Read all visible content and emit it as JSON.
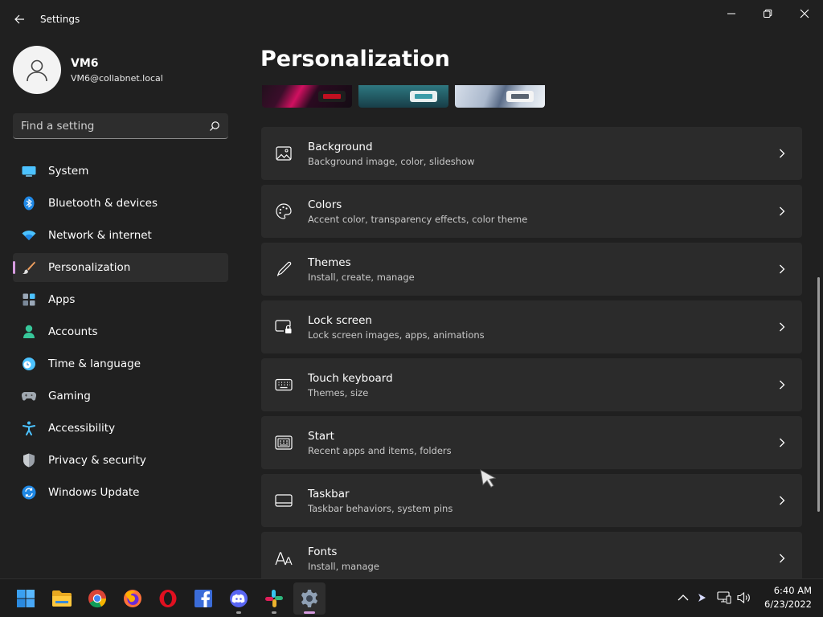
{
  "window": {
    "app_title": "Settings"
  },
  "profile": {
    "name": "VM6",
    "email": "VM6@collabnet.local"
  },
  "search": {
    "placeholder": "Find a setting"
  },
  "sidebar": {
    "items": [
      {
        "label": "System",
        "icon": "system-icon",
        "selected": false
      },
      {
        "label": "Bluetooth & devices",
        "icon": "bluetooth-icon",
        "selected": false
      },
      {
        "label": "Network & internet",
        "icon": "wifi-icon",
        "selected": false
      },
      {
        "label": "Personalization",
        "icon": "brush-icon",
        "selected": true
      },
      {
        "label": "Apps",
        "icon": "apps-icon",
        "selected": false
      },
      {
        "label": "Accounts",
        "icon": "accounts-icon",
        "selected": false
      },
      {
        "label": "Time & language",
        "icon": "globe-clock-icon",
        "selected": false
      },
      {
        "label": "Gaming",
        "icon": "gamepad-icon",
        "selected": false
      },
      {
        "label": "Accessibility",
        "icon": "accessibility-icon",
        "selected": false
      },
      {
        "label": "Privacy & security",
        "icon": "shield-icon",
        "selected": false
      },
      {
        "label": "Windows Update",
        "icon": "update-icon",
        "selected": false
      }
    ]
  },
  "main": {
    "title": "Personalization",
    "settings": [
      {
        "title": "Background",
        "desc": "Background image, color, slideshow",
        "icon": "image-icon"
      },
      {
        "title": "Colors",
        "desc": "Accent color, transparency effects, color theme",
        "icon": "palette-icon"
      },
      {
        "title": "Themes",
        "desc": "Install, create, manage",
        "icon": "pen-icon"
      },
      {
        "title": "Lock screen",
        "desc": "Lock screen images, apps, animations",
        "icon": "lock-screen-icon"
      },
      {
        "title": "Touch keyboard",
        "desc": "Themes, size",
        "icon": "keyboard-icon"
      },
      {
        "title": "Start",
        "desc": "Recent apps and items, folders",
        "icon": "start-menu-icon"
      },
      {
        "title": "Taskbar",
        "desc": "Taskbar behaviors, system pins",
        "icon": "taskbar-icon"
      },
      {
        "title": "Fonts",
        "desc": "Install, manage",
        "icon": "fonts-icon"
      }
    ]
  },
  "taskbar": {
    "apps": [
      "start-icon",
      "file-explorer-icon",
      "chrome-icon",
      "firefox-icon",
      "opera-icon",
      "facebook-icon",
      "discord-icon",
      "slack-icon",
      "settings-icon"
    ],
    "time": "6:40 AM",
    "date": "6/23/2022"
  },
  "colors": {
    "accent": "#d59bdf",
    "background": "#202020",
    "card": "#2b2b2b"
  }
}
